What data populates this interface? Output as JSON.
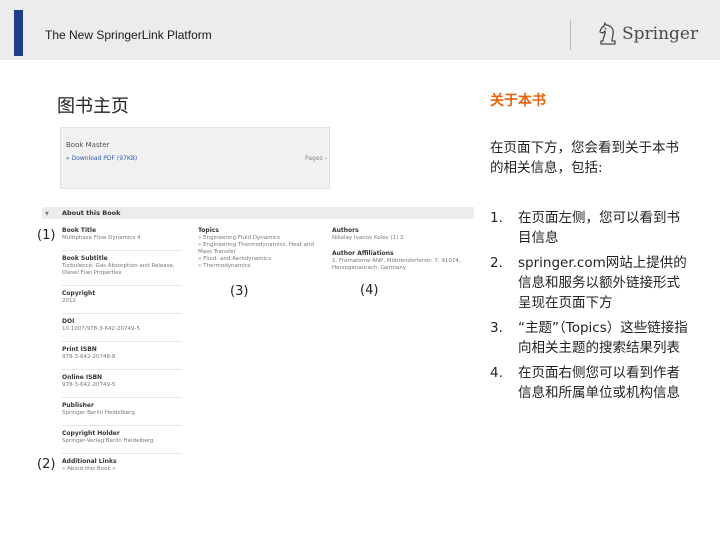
{
  "header": {
    "title": "The New SpringerLink Platform",
    "logo_text": "Springer",
    "accent_color": "#1f3f8a"
  },
  "left_title": "图书主页",
  "right_title": "关于本书",
  "right_title_color": "#e8640c",
  "screenshot": {
    "book_name": "Book Master",
    "download": "» Download PDF (97KB)",
    "pages": "Pages –",
    "about_label": "About this Book",
    "col1": [
      {
        "label": "Book Title",
        "value": "Multiphase Flow Dynamics 4"
      },
      {
        "label": "Book Subtitle",
        "value": "Turbulence, Gas Absorption and Release, Diesel Fuel Properties"
      },
      {
        "label": "Copyright",
        "value": "2012"
      },
      {
        "label": "DOI",
        "value": "10.1007/978-3-642-20749-5"
      },
      {
        "label": "Print ISBN",
        "value": "978-3-642-20748-8"
      },
      {
        "label": "Online ISBN",
        "value": "978-3-642-20749-5"
      },
      {
        "label": "Publisher",
        "value": "Springer Berlin Heidelberg"
      },
      {
        "label": "Copyright Holder",
        "value": "Springer-Verlag Berlin Heidelberg"
      },
      {
        "label": "Additional Links",
        "value": "» About this Book »"
      }
    ],
    "col2": {
      "label": "Topics",
      "items": [
        "» Engineering Fluid Dynamics",
        "» Engineering Thermodynamics, Heat and Mass Transfer",
        "» Fluid- and Aerodynamics",
        "» Thermodynamics"
      ]
    },
    "col3": [
      {
        "label": "Authors",
        "value": "Nikolay Ivanov Kolev (1) 2"
      },
      {
        "label": "Author Affiliations",
        "value": "1. Framatome ANP, Möhrendorferstr. 7, 91074, Herzogenaurach, Germany"
      }
    ]
  },
  "annotations": [
    "(1)",
    "(2)",
    "(3)",
    "(4)"
  ],
  "intro": "在页面下方，您会看到关于本书的相关信息，包括:",
  "items": [
    {
      "num": "1.",
      "text": "在页面左侧，您可以看到书目信息"
    },
    {
      "num": "2.",
      "text": "springer.com网站上提供的信息和服务以额外链接形式呈现在页面下方"
    },
    {
      "num": "3.",
      "text": "“主题”（Topics）这些链接指向相关主题的搜索结果列表"
    },
    {
      "num": "4.",
      "text": "在页面右侧您可以看到作者信息和所属单位或机构信息"
    }
  ]
}
